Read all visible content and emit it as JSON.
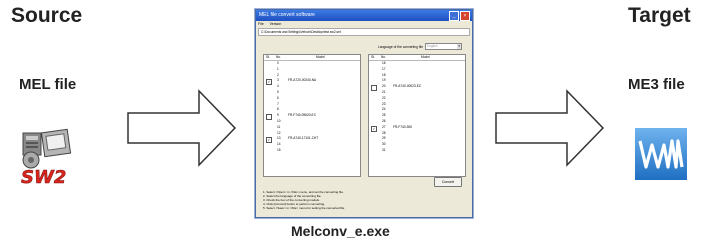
{
  "labels": {
    "source_title": "Source",
    "target_title": "Target",
    "source_file": "MEL file",
    "target_file": "ME3 file",
    "exe_caption": "Melconv_e.exe"
  },
  "window": {
    "title": "MEL file convert software",
    "menu": [
      "File",
      "Version"
    ],
    "path": "C:\\Documents and Settings\\Vehuin\\Desktop\\test.sw2.set",
    "language_label": "Language of the converting file",
    "language_value": "English",
    "columns": {
      "st": "St.",
      "no": "No.",
      "model": "Model"
    },
    "left_rows": [
      {
        "no": "0",
        "checked": false,
        "model": ""
      },
      {
        "no": "1",
        "checked": false,
        "model": ""
      },
      {
        "no": "2",
        "checked": false,
        "model": ""
      },
      {
        "no": "3",
        "checked": true,
        "model": "FR-A720-00240-NA"
      },
      {
        "no": "4",
        "checked": false,
        "model": ""
      },
      {
        "no": "5",
        "checked": false,
        "model": ""
      },
      {
        "no": "6",
        "checked": false,
        "model": ""
      },
      {
        "no": "7",
        "checked": false,
        "model": ""
      },
      {
        "no": "8",
        "checked": false,
        "model": ""
      },
      {
        "no": "9",
        "checked": false,
        "model": "FR-F740-09620-EC"
      },
      {
        "no": "10",
        "checked": false,
        "model": ""
      },
      {
        "no": "11",
        "checked": false,
        "model": ""
      },
      {
        "no": "12",
        "checked": false,
        "model": ""
      },
      {
        "no": "13",
        "checked": true,
        "model": "FR-A740-17101-CHT"
      },
      {
        "no": "14",
        "checked": false,
        "model": ""
      },
      {
        "no": "15",
        "checked": false,
        "model": ""
      }
    ],
    "right_rows": [
      {
        "no": "16",
        "checked": false,
        "model": ""
      },
      {
        "no": "17",
        "checked": false,
        "model": ""
      },
      {
        "no": "18",
        "checked": false,
        "model": ""
      },
      {
        "no": "19",
        "checked": false,
        "model": ""
      },
      {
        "no": "20",
        "checked": false,
        "model": "FR-A740-00023-EC"
      },
      {
        "no": "21",
        "checked": false,
        "model": ""
      },
      {
        "no": "22",
        "checked": false,
        "model": ""
      },
      {
        "no": "23",
        "checked": false,
        "model": ""
      },
      {
        "no": "24",
        "checked": false,
        "model": ""
      },
      {
        "no": "25",
        "checked": false,
        "model": ""
      },
      {
        "no": "26",
        "checked": false,
        "model": ""
      },
      {
        "no": "27",
        "checked": true,
        "model": "FR-F740-30K"
      },
      {
        "no": "28",
        "checked": false,
        "model": ""
      },
      {
        "no": "29",
        "checked": false,
        "model": ""
      },
      {
        "no": "30",
        "checked": false,
        "model": ""
      },
      {
        "no": "31",
        "checked": false,
        "model": ""
      }
    ],
    "convert_label": "Convert",
    "instructions": [
      "1. Select <Open> in <File> menu, and set the converting file.",
      "2. Select the language of the converting file.",
      "3. Check the box of the converting models.",
      "4. Click [Convert] button to perform converting.",
      "5. Select <Save> in <File> menu for setting the converted file."
    ]
  }
}
